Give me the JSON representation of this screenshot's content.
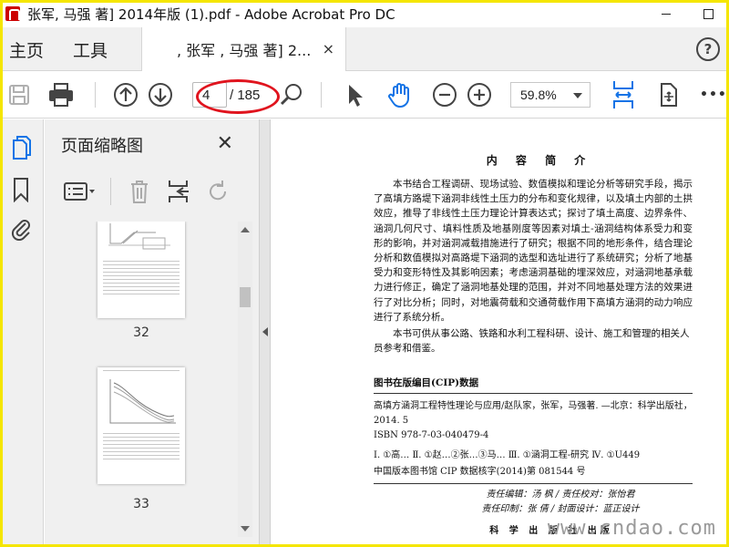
{
  "window": {
    "title": "张军, 马强 著] 2014年版 (1).pdf - Adobe Acrobat Pro DC",
    "minimize": "—",
    "maximize": "□"
  },
  "menubar": {
    "home": "主页",
    "tools": "工具",
    "tab_title": ", 张军 , 马强 著] 2...",
    "tab_close": "×",
    "help": "?"
  },
  "toolbar": {
    "current_page": "4",
    "total_pages": "/ 185",
    "zoom": "59.8%",
    "more": "•••"
  },
  "panel": {
    "title": "页面缩略图",
    "close": "✕",
    "thumbnails": [
      {
        "label": "32"
      },
      {
        "label": "33"
      }
    ]
  },
  "document": {
    "heading": "内 容 简 介",
    "para1": "本书结合工程调研、现场试验、数值模拟和理论分析等研究手段，揭示了高填方路堤下涵洞非线性土压力的分布和变化规律，以及填土内部的土拱效应，推导了非线性土压力理论计算表达式；探讨了填土高度、边界条件、涵洞几何尺寸、填料性质及地基刚度等因素对填土-涵洞结构体系受力和变形的影响，并对涵洞减载措施进行了研究；根据不同的地形条件，结合理论分析和数值模拟对高路堤下涵洞的选型和选址进行了系统研究；分析了地基受力和变形特性及其影响因素；考虑涵洞基础的埋深效应，对涵洞地基承载力进行修正，确定了涵洞地基处理的范围，并对不同地基处理方法的效果进行了对比分析；同时，对地震荷载和交通荷载作用下高填方涵洞的动力响应进行了系统分析。",
    "para2": "本书可供从事公路、铁路和水利工程科研、设计、施工和管理的相关人员参考和借鉴。",
    "cip_title": "图书在版编目(CIP)数据",
    "cip_book": "高填方涵洞工程特性理论与应用/赵队家，张军，马强著. —北京：科学出版社，2014. 5",
    "isbn": "ISBN 978-7-03-040479-4",
    "classification": "Ⅰ. ①高…   Ⅱ. ①赵…②张…③马…   Ⅲ. ①涵洞工程-研究   Ⅳ. ①U449",
    "cip_number": "中国版本图书馆 CIP 数据核字(2014)第 081544 号",
    "editors": "责任编辑：汤 枫 / 责任校对：张怡君",
    "printing": "责任印制：张 倩 / 封面设计：蓝正设计",
    "publisher": "科 学 出 版 社 出版"
  },
  "watermark": "www.cndao.com",
  "colors": {
    "accent_blue": "#1473e6",
    "annotation_red": "#e0141e",
    "frame_yellow": "#f5e600"
  }
}
